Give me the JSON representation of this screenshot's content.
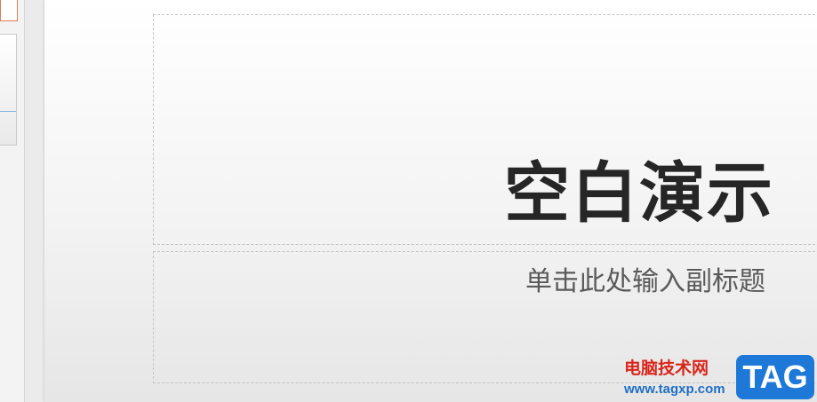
{
  "slide": {
    "title": "空白演示",
    "subtitle": "单击此处输入副标题"
  },
  "watermark": {
    "site_name": "电脑技术网",
    "url": "www.tagxp.com",
    "badge": "TAG"
  },
  "colors": {
    "slide_title": "#262626",
    "slide_subtitle": "#5a5a5a",
    "thumbnail_selected_border": "#e07a55",
    "watermark_red": "#d9261c",
    "watermark_blue": "#1e78d8"
  }
}
